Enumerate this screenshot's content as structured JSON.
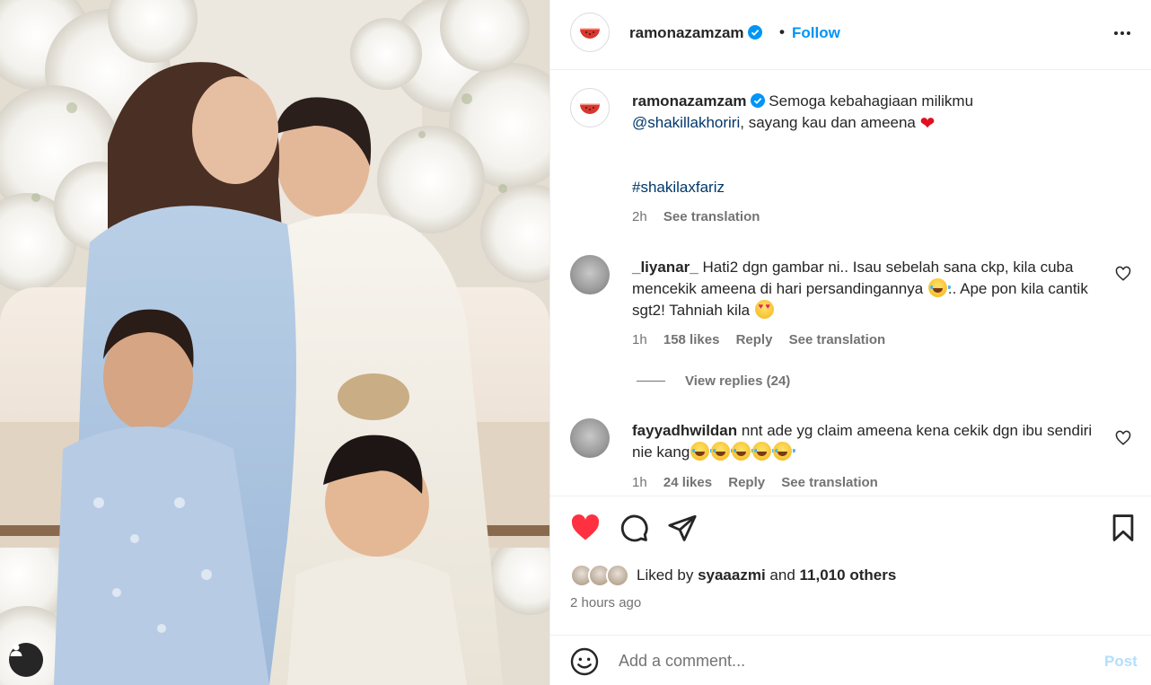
{
  "post": {
    "username": "ramonazamzam",
    "verified": true,
    "follow_label": "Follow",
    "separator": "•"
  },
  "caption": {
    "username": "ramonazamzam",
    "text_1": "Semoga kebahagiaan milikmu",
    "mention": "@shakillakhoriri",
    "text_2": ", sayang kau dan ameena",
    "hashtag": "#shakilaxfariz",
    "time": "2h",
    "see_translation": "See translation"
  },
  "comments": [
    {
      "username": "_liyanar_",
      "text_1": "Hati2 dgn gambar ni.. Isau sebelah sana ckp, kila cuba mencekik ameena di hari persandingannya",
      "text_2": ".. Ape pon kila cantik sgt2! Tahniah kila",
      "time": "1h",
      "likes": "158 likes",
      "reply": "Reply",
      "see_translation": "See translation",
      "view_replies": "View replies (24)"
    },
    {
      "username": "fayyadhwildan",
      "text": "nnt ade yg claim ameena kena cekik dgn ibu sendiri nie kang",
      "time": "1h",
      "likes": "24 likes",
      "reply": "Reply",
      "see_translation": "See translation"
    }
  ],
  "likes": {
    "prefix": "Liked by",
    "user": "syaaazmi",
    "and": "and",
    "others": "11,010 others"
  },
  "time_ago": "2 hours ago",
  "comment_box": {
    "placeholder": "Add a comment...",
    "post_label": "Post"
  },
  "colors": {
    "accent": "#0095f6",
    "mention": "#00376b",
    "like_red": "#ff3040",
    "post_disabled": "#b2dffc"
  },
  "icons": {
    "like": "heart-icon",
    "comment": "comment-icon",
    "share": "share-icon",
    "save": "bookmark-icon",
    "more": "more-icon",
    "emoji": "smile-icon"
  }
}
